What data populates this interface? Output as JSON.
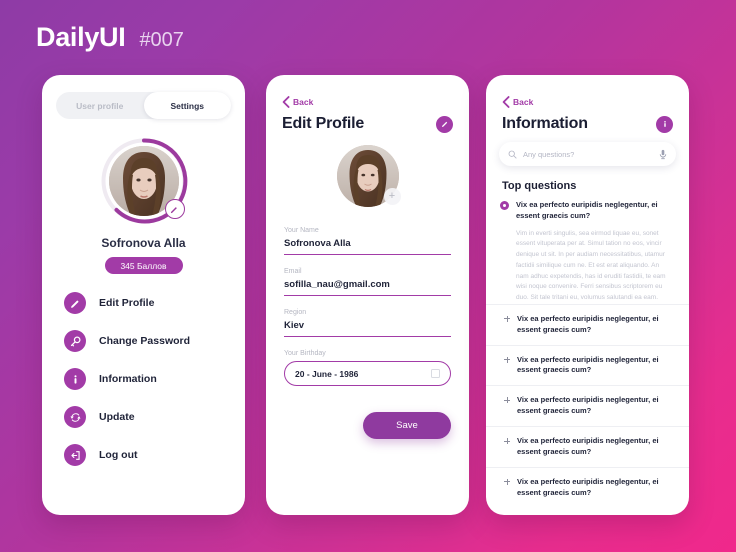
{
  "header": {
    "brand": "DailyUI",
    "challenge_number": "#007"
  },
  "colors": {
    "accent_purple": "#a23ba7",
    "accent_deep": "#8f3a9f",
    "bg_gradient_start": "#8e3ba6",
    "bg_gradient_end": "#f0288b",
    "text_dark": "#1f2338",
    "text_muted": "#b5b7c2"
  },
  "profile_card": {
    "tabs": [
      {
        "label": "User profile",
        "active": false
      },
      {
        "label": "Settings",
        "active": true
      }
    ],
    "avatar_icon": "user-photo",
    "avatar_edit_icon": "pencil-icon",
    "name": "Sofronova Alla",
    "points_badge": "345 Баллов",
    "menu": [
      {
        "label": "Edit Profile",
        "icon": "pencil-icon"
      },
      {
        "label": "Change Password",
        "icon": "key-icon"
      },
      {
        "label": "Information",
        "icon": "info-icon"
      },
      {
        "label": "Update",
        "icon": "refresh-icon"
      },
      {
        "label": "Log out",
        "icon": "logout-icon"
      }
    ]
  },
  "edit_card": {
    "back_label": "Back",
    "back_icon": "chevron-left-icon",
    "title": "Edit Profile",
    "title_badge_icon": "pencil-icon",
    "avatar_icon": "user-photo",
    "avatar_add_icon": "plus-icon",
    "fields": [
      {
        "label": "Your Name",
        "value": "Sofronova Alla"
      },
      {
        "label": "Email",
        "value": "sofilla_nau@gmail.com"
      },
      {
        "label": "Region",
        "value": "Kiev"
      }
    ],
    "birthday": {
      "label": "Your Birthday",
      "value": "20 - June - 1986",
      "icon": "calendar-icon"
    },
    "save_label": "Save"
  },
  "info_card": {
    "back_label": "Back",
    "back_icon": "chevron-left-icon",
    "title": "Information",
    "title_badge_icon": "info-icon",
    "search": {
      "placeholder": "Any questions?",
      "value": "",
      "search_icon": "search-icon",
      "mic_icon": "microphone-icon"
    },
    "section_title": "Top questions",
    "open_question": {
      "question": "Vix ea perfecto euripidis neglegentur, ei essent graecis cum?",
      "answer": "Vim in everti singulis, sea eirmod liquae eu, sonet essent vituperata per at. Simul tation no eos, vincir denique ut sit. In per audiam necessitatibus, utamur factidii similique cum ne. Et est erat aliquando. An nam adhuc expetendis, has id eruditi fastidii, te eam wisi noque convenire. Ferri sensibus scriptorem eu duo. Sit tale tritani eu, volumus salutandi ea eam."
    },
    "questions": [
      "Vix ea perfecto euripidis neglegentur, ei essent graecis cum?",
      "Vix ea perfecto euripidis neglegentur, ei essent graecis cum?",
      "Vix ea perfecto euripidis neglegentur, ei essent graecis cum?",
      "Vix ea perfecto euripidis neglegentur, ei essent graecis cum?",
      "Vix ea perfecto euripidis neglegentur, ei essent graecis cum?"
    ]
  }
}
